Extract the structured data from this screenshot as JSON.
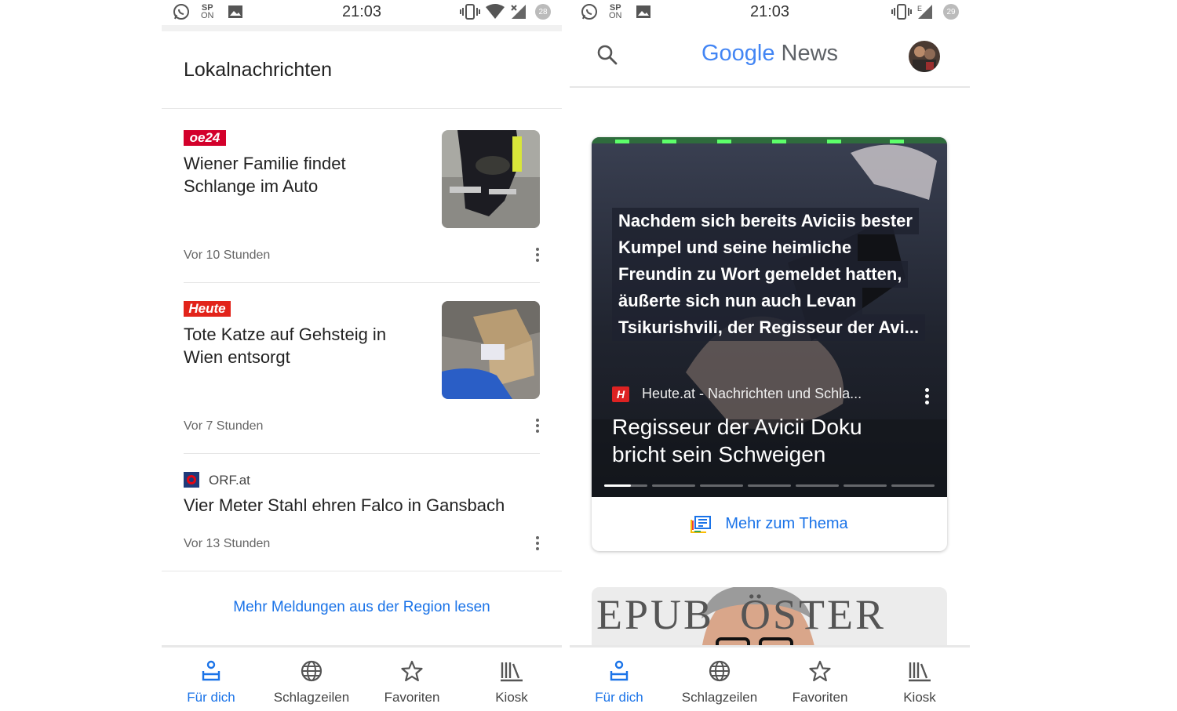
{
  "status_left": {
    "time": "21:03",
    "sp_top": "SP",
    "sp_bottom": "ON",
    "battery": "28"
  },
  "status_right": {
    "time": "21:03",
    "sp_top": "SP",
    "sp_bottom": "ON",
    "battery": "29",
    "network": "E"
  },
  "left": {
    "section_title": "Lokalnachrichten",
    "articles": [
      {
        "source_logo": "oe24",
        "title_line1": "Wiener Familie findet",
        "title_line2": "Schlange im Auto",
        "time": "Vor 10 Stunden"
      },
      {
        "source_logo": "Heute",
        "title_line1": "Tote Katze auf Gehsteig in",
        "title_line2": "Wien entsorgt",
        "time": "Vor 7 Stunden"
      },
      {
        "source": "ORF.at",
        "title": "Vier Meter Stahl ehren Falco in Gansbach",
        "time": "Vor 13 Stunden"
      }
    ],
    "more_link": "Mehr Meldungen aus der Region lesen"
  },
  "right": {
    "logo_word1": "Google",
    "logo_word2": "News",
    "hero": {
      "quote_lines": [
        "Nachdem sich bereits Aviciis bester",
        "Kumpel und seine heimliche",
        "Freundin zu Wort gemeldet hatten,",
        "äußerte sich nun auch Levan",
        "Tsikurishvili, der Regisseur der Avi..."
      ],
      "source_logo": "H",
      "source": "Heute.at - Nachrichten und Schla...",
      "title_line1": "Regisseur der Avicii Doku",
      "title_line2": "bricht sein Schweigen"
    },
    "more_topic": "Mehr zum Thema",
    "second_card_text": "EPUB  ÖSTER"
  },
  "nav": {
    "items": [
      {
        "label": "Für dich",
        "icon": "for-you-icon"
      },
      {
        "label": "Schlagzeilen",
        "icon": "globe-icon"
      },
      {
        "label": "Favoriten",
        "icon": "star-icon"
      },
      {
        "label": "Kiosk",
        "icon": "newsstand-icon"
      }
    ]
  },
  "colors": {
    "accent": "#1a73e8",
    "hero_bg": "#23283a",
    "oe24_red": "#d3002b",
    "heute_red": "#e2231a"
  }
}
